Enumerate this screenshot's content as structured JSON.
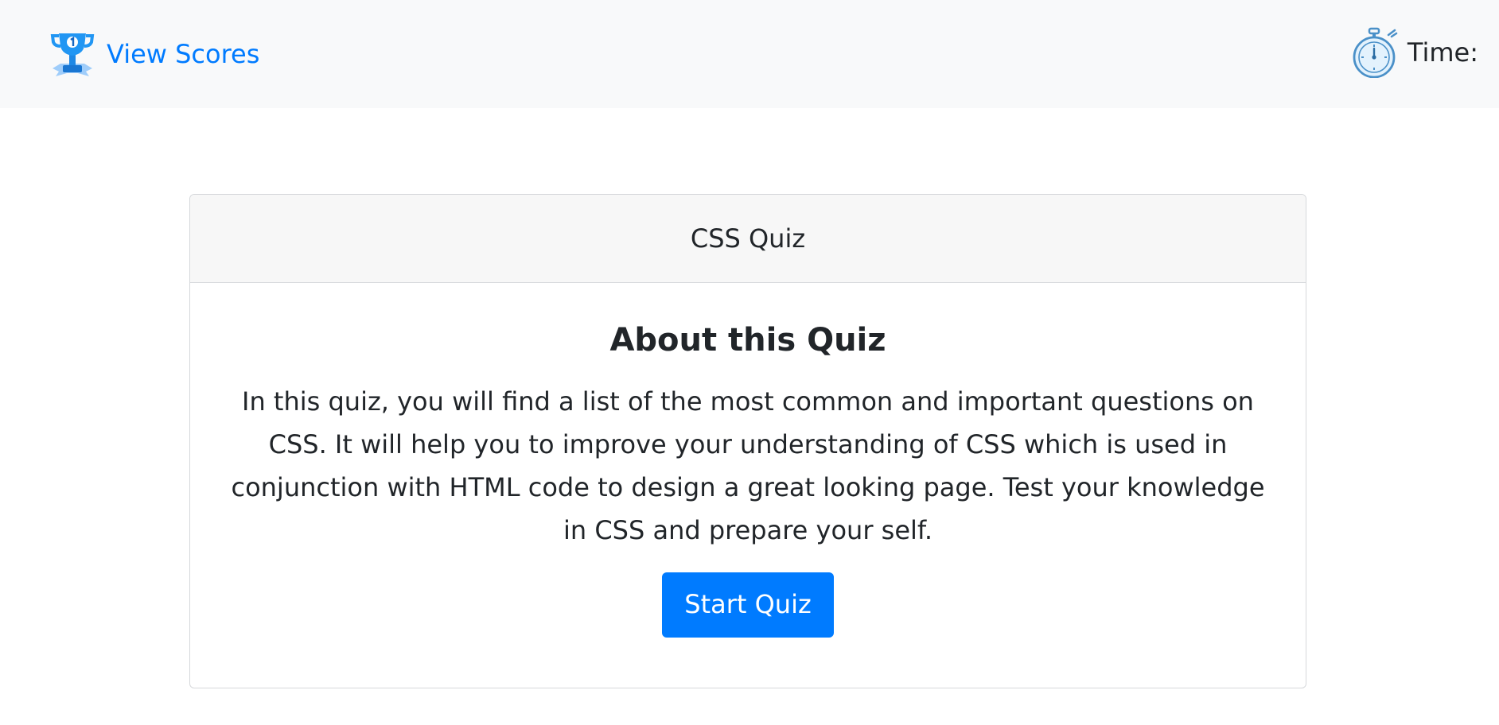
{
  "navbar": {
    "scores_link": "View Scores",
    "timer_label": "Time:",
    "icons": {
      "scores": "trophy-icon",
      "timer": "stopwatch-icon"
    }
  },
  "card": {
    "header": "CSS Quiz",
    "title": "About this Quiz",
    "description": "In this quiz, you will find a list of the most common and important questions on CSS. It will help you to improve your understanding of CSS which is used in conjunction with HTML code to design a great looking page. Test your knowledge in CSS and prepare your self.",
    "start_button": "Start Quiz"
  },
  "colors": {
    "accent": "#007bff",
    "navbar_bg": "#f8f9fa",
    "card_header_bg": "#f7f7f7",
    "text": "#212529"
  }
}
